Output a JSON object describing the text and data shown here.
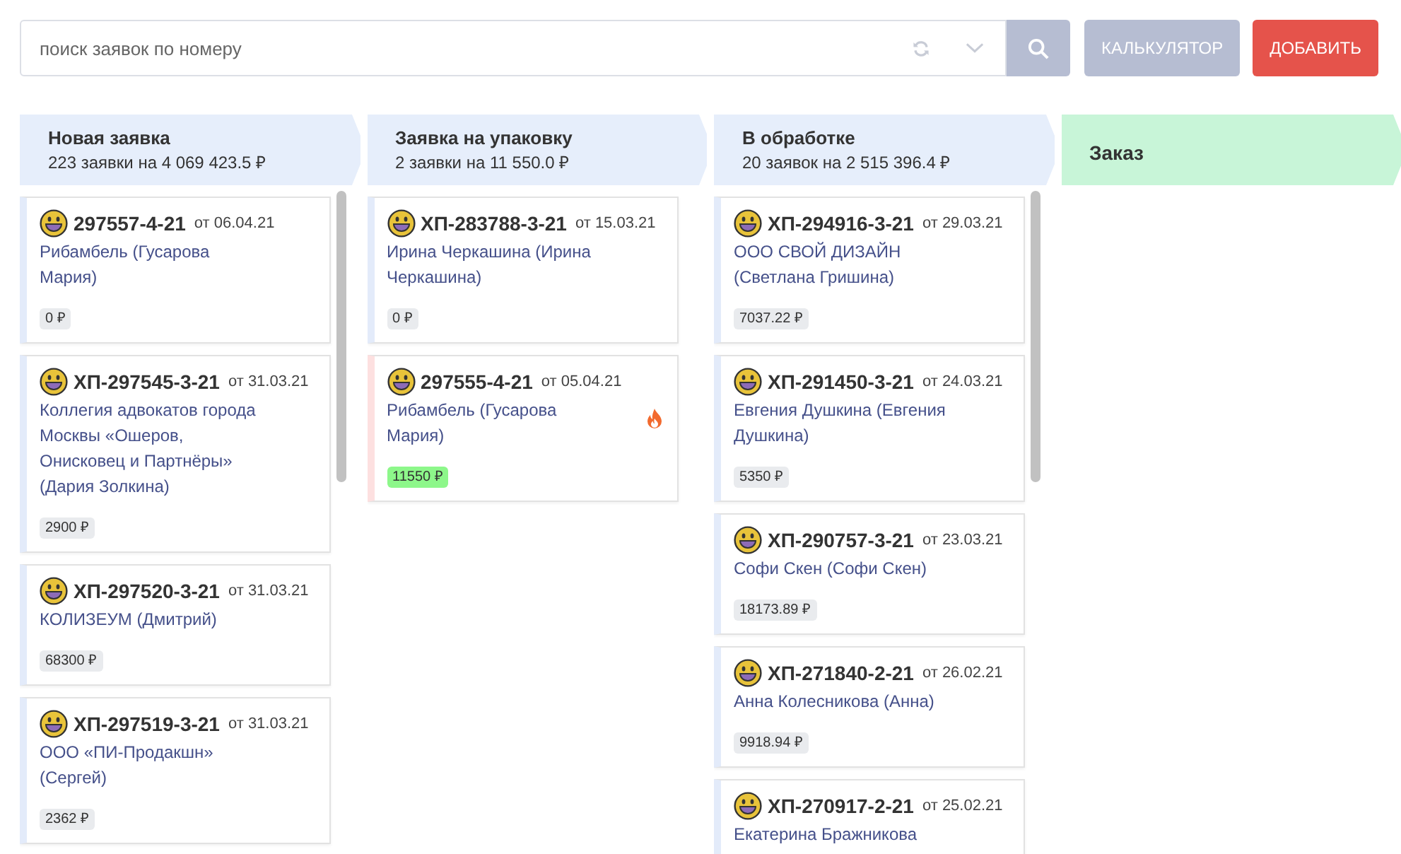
{
  "toolbar": {
    "search": {
      "placeholder": "поиск заявок по номеру"
    },
    "buttons": [
      {
        "label": "КАЛЬКУЛЯТОР",
        "kind": "secondary"
      },
      {
        "label": "ДОБАВИТЬ",
        "kind": "primary"
      }
    ]
  },
  "columns": [
    {
      "title": "Новая заявка",
      "summary": "223 заявки на 4 069 423.5 ₽",
      "color": "#e6eefb",
      "scrollbar": true,
      "cards": [
        {
          "number": "297557-4-21",
          "date": "от 06.04.21",
          "client": "Рибамбель (Гусарова Мария)",
          "amount": "0 ₽",
          "hot": false
        },
        {
          "number": "ХП-297545-3-21",
          "date": "от 31.03.21",
          "client": "Коллегия адвокатов города Москвы «Ошеров, Онисковец и Партнёры» (Дария Золкина)",
          "amount": "2900 ₽",
          "hot": false
        },
        {
          "number": "ХП-297520-3-21",
          "date": "от 31.03.21",
          "client": "КОЛИЗЕУМ (Дмитрий)",
          "amount": "68300 ₽",
          "hot": false
        },
        {
          "number": "ХП-297519-3-21",
          "date": "от 31.03.21",
          "client": "ООО «ПИ-Продакшн» (Сергей)",
          "amount": "2362 ₽",
          "hot": false
        }
      ]
    },
    {
      "title": "Заявка на упаковку",
      "summary": "2 заявки на 11 550.0 ₽",
      "color": "#e6eefb",
      "scrollbar": false,
      "cards": [
        {
          "number": "ХП-283788-3-21",
          "date": "от 15.03.21",
          "client": "Ирина Черкашина (Ирина Черкашина)",
          "amount": "0 ₽",
          "hot": false
        },
        {
          "number": "297555-4-21",
          "date": "от 05.04.21",
          "client": "Рибамбель (Гусарова Мария)",
          "amount": "11550 ₽",
          "hot": true
        }
      ]
    },
    {
      "title": "В обработке",
      "summary": "20 заявок на 2 515 396.4 ₽",
      "color": "#e6eefb",
      "scrollbar": true,
      "cards": [
        {
          "number": "ХП-294916-3-21",
          "date": "от 29.03.21",
          "client": "ООО СВОЙ ДИЗАЙН (Светлана Гришина)",
          "amount": "7037.22 ₽",
          "hot": false
        },
        {
          "number": "ХП-291450-3-21",
          "date": "от 24.03.21",
          "client": "Евгения Душкина (Евгения Душкина)",
          "amount": "5350 ₽",
          "hot": false
        },
        {
          "number": "ХП-290757-3-21",
          "date": "от 23.03.21",
          "client": "Софи Скен (Софи Скен)",
          "amount": "18173.89 ₽",
          "hot": false
        },
        {
          "number": "ХП-271840-2-21",
          "date": "от 26.02.21",
          "client": "Анна Колесникова (Анна)",
          "amount": "9918.94 ₽",
          "hot": false
        },
        {
          "number": "ХП-270917-2-21",
          "date": "от 25.02.21",
          "client": "Екатерина Бражникова",
          "hot": false
        }
      ]
    },
    {
      "title": "Заказ",
      "color": "#c8f5d8",
      "scrollbar": false
    }
  ]
}
